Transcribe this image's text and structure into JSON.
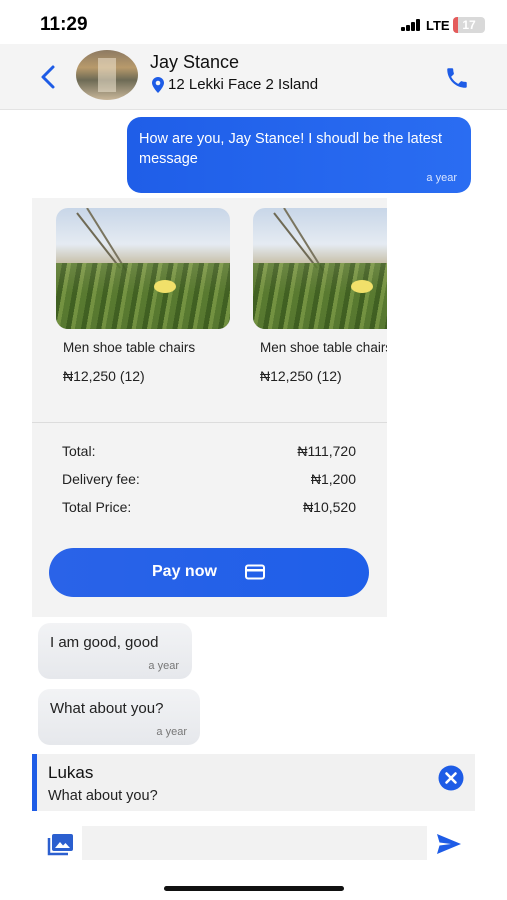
{
  "status_bar": {
    "time": "11:29",
    "network": "LTE",
    "battery_level": "17",
    "battery_fraction": 0.17
  },
  "header": {
    "contact_name": "Jay Stance",
    "address": "12 Lekki Face 2 Island",
    "icons": [
      "back-arrow-icon",
      "location-pin-icon",
      "phone-icon"
    ]
  },
  "messages": {
    "outgoing_1": {
      "text": "How are you, Jay Stance! I shoudl be the latest message",
      "time": "a year"
    },
    "incoming_1": {
      "text": "I am good, good",
      "time": "a year"
    },
    "incoming_2": {
      "text": "What about you?",
      "time": "a year"
    }
  },
  "order": {
    "products": [
      {
        "name": "Men shoe table chairs",
        "price": "₦12,250 (12)"
      },
      {
        "name": "Men shoe table chairs",
        "price": "₦12,250 (12)"
      }
    ],
    "total_label": "Total:",
    "total_value": "₦111,720",
    "delivery_label": "Delivery fee:",
    "delivery_value": "₦1,200",
    "total_price_label": "Total Price:",
    "total_price_value": "₦10,520",
    "pay_button": "Pay now"
  },
  "reply_preview": {
    "author": "Lukas",
    "text": "What about you?"
  },
  "composer": {
    "placeholder": ""
  },
  "colors": {
    "accent": "#1f5ee8",
    "bubble_incoming": "#eceef1",
    "card_bg": "#f3f3f3"
  }
}
